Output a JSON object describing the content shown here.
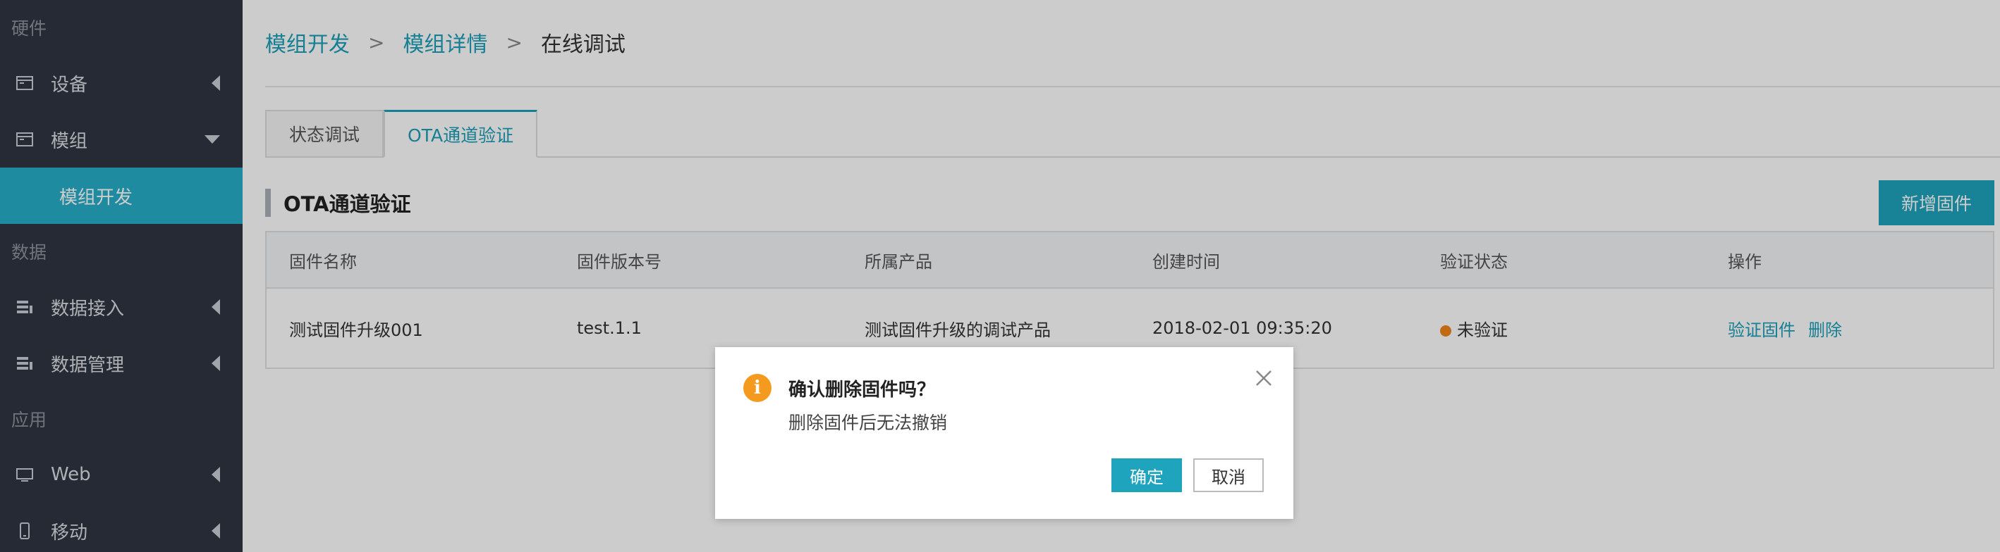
{
  "sidebar": {
    "sections": [
      "硬件",
      "数据",
      "应用"
    ],
    "items": [
      {
        "label": "设备",
        "icon": "window-icon"
      },
      {
        "label": "模组",
        "icon": "window-icon"
      },
      {
        "label": "数据接入",
        "icon": "list-icon"
      },
      {
        "label": "数据管理",
        "icon": "list-icon"
      },
      {
        "label": "Web",
        "icon": "monitor-icon"
      },
      {
        "label": "移动",
        "icon": "mobile-icon"
      }
    ],
    "active_sub": "模组开发"
  },
  "breadcrumb": {
    "items": [
      "模组开发",
      "模组详情",
      "在线调试"
    ],
    "separator": ">"
  },
  "tabs": [
    {
      "label": "状态调试"
    },
    {
      "label": "OTA通道验证"
    }
  ],
  "section": {
    "title": "OTA通道验证",
    "add_button": "新增固件"
  },
  "table": {
    "headers": [
      "固件名称",
      "固件版本号",
      "所属产品",
      "创建时间",
      "验证状态",
      "操作"
    ],
    "rows": [
      {
        "name": "测试固件升级001",
        "version": "test.1.1",
        "product": "测试固件升级的调试产品",
        "created": "2018-02-01 09:35:20",
        "status": "未验证",
        "actions": [
          "验证固件",
          "删除"
        ]
      }
    ]
  },
  "dialog": {
    "icon": "info-icon",
    "icon_glyph": "i",
    "title": "确认删除固件吗？",
    "message": "删除固件后无法撤销",
    "ok": "确定",
    "cancel": "取消"
  },
  "colors": {
    "sidebar_bg": "#2f3541",
    "accent": "#1ea4bd",
    "warning": "#f39a1f",
    "status_dot": "#f08519"
  }
}
